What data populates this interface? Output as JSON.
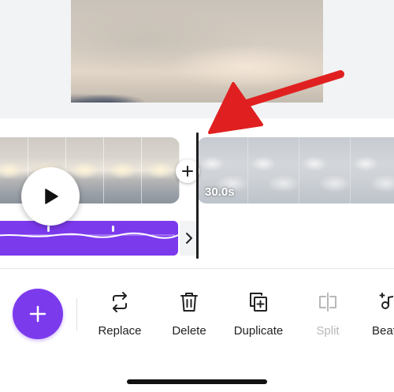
{
  "timeline": {
    "clip_duration": "30.0s"
  },
  "toolbar": {
    "tools": [
      {
        "label": "Replace",
        "icon": "replace-icon",
        "enabled": true
      },
      {
        "label": "Delete",
        "icon": "trash-icon",
        "enabled": true
      },
      {
        "label": "Duplicate",
        "icon": "duplicate-icon",
        "enabled": true
      },
      {
        "label": "Split",
        "icon": "split-icon",
        "enabled": false
      },
      {
        "label": "Beat",
        "icon": "beat-sync-icon",
        "enabled": true
      }
    ]
  },
  "colors": {
    "accent": "#7c3aed",
    "annotation": "#e02020",
    "disabled": "#b8b8b8"
  }
}
